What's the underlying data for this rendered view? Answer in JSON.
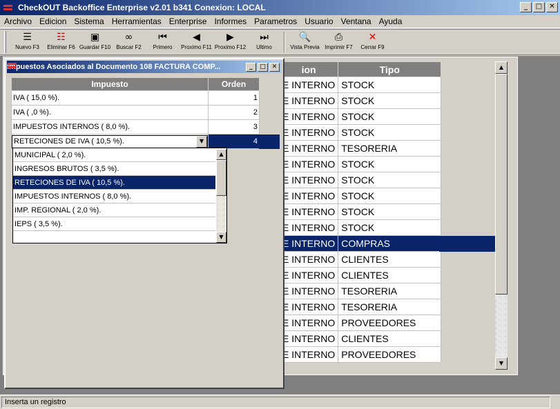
{
  "app": {
    "title": "CheckOUT Backoffice Enterprise v2.01 b341 Conexion: LOCAL",
    "window_buttons": [
      "_",
      "□",
      "✕"
    ]
  },
  "menu": [
    "Archivo",
    "Edicion",
    "Sistema",
    "Herramientas",
    "Enterprise",
    "Informes",
    "Parametros",
    "Usuario",
    "Ventana",
    "Ayuda"
  ],
  "toolbar": [
    {
      "label": "Nuevo F3",
      "icon": "new-icon"
    },
    {
      "label": "Eliminar F6",
      "icon": "delete-icon"
    },
    {
      "label": "Guardar F10",
      "icon": "save-icon"
    },
    {
      "label": "Buscar F2",
      "icon": "binoculars-icon"
    },
    {
      "label": "Primero",
      "icon": "first-icon"
    },
    {
      "label": "Proximo F11",
      "icon": "prev-icon"
    },
    {
      "label": "Proximo F12",
      "icon": "next-icon"
    },
    {
      "label": "Ultimo",
      "icon": "last-icon"
    },
    {
      "label": "Vista Previa",
      "icon": "preview-icon"
    },
    {
      "label": "Imprimir F7",
      "icon": "printer-icon"
    },
    {
      "label": "Cerrar F9",
      "icon": "close-red-icon"
    }
  ],
  "background_grid": {
    "headers": [
      "ion",
      "Tipo"
    ],
    "rows": [
      [
        "E INTERNO",
        "STOCK"
      ],
      [
        "E INTERNO",
        "STOCK"
      ],
      [
        "E INTERNO",
        "STOCK"
      ],
      [
        "E INTERNO",
        "STOCK"
      ],
      [
        "E INTERNO",
        "TESORERIA"
      ],
      [
        "E INTERNO",
        "STOCK"
      ],
      [
        "E INTERNO",
        "STOCK"
      ],
      [
        "E INTERNO",
        "STOCK"
      ],
      [
        "E INTERNO",
        "STOCK"
      ],
      [
        "E INTERNO",
        "STOCK"
      ],
      [
        "E INTERNO",
        "COMPRAS"
      ],
      [
        "E INTERNO",
        "CLIENTES"
      ],
      [
        "E INTERNO",
        "CLIENTES"
      ],
      [
        "E INTERNO",
        "TESORERIA"
      ],
      [
        "E INTERNO",
        "TESORERIA"
      ],
      [
        "E INTERNO",
        "PROVEEDORES"
      ],
      [
        "E INTERNO",
        "CLIENTES"
      ],
      [
        "E INTERNO",
        "PROVEEDORES"
      ]
    ],
    "selected_row": 10
  },
  "dialog": {
    "title": "Impuestos Asociados al Documento 108 FACTURA COMP...",
    "headers": [
      "Impuesto",
      "Orden"
    ],
    "rows": [
      {
        "impuesto": "IVA  ( 15,0 %).",
        "orden": "1"
      },
      {
        "impuesto": "IVA  ( ,0 %).",
        "orden": "2"
      },
      {
        "impuesto": "IMPUESTOS INTERNOS  ( 8,0 %).",
        "orden": "3"
      }
    ],
    "editing_row": {
      "impuesto": "RETECIONES DE IVA  ( 10,5 %).",
      "orden": "4"
    },
    "dropdown_options": [
      "MUNICIPAL  ( 2,0 %).",
      "INGRESOS BRUTOS  ( 3,5 %).",
      "RETECIONES DE IVA  ( 10,5 %).",
      "IMPUESTOS INTERNOS  ( 8,0 %).",
      "IMP. REGIONAL  ( 2,0 %).",
      " IEPS  ( 3,5 %)."
    ],
    "dropdown_selected": 2
  },
  "status": {
    "text": "Inserta un registro"
  },
  "colors": {
    "selection": "#0a246a",
    "face": "#d4d0c8",
    "mdi": "#808080",
    "title_start": "#0a246a",
    "title_end": "#a6caf0"
  }
}
